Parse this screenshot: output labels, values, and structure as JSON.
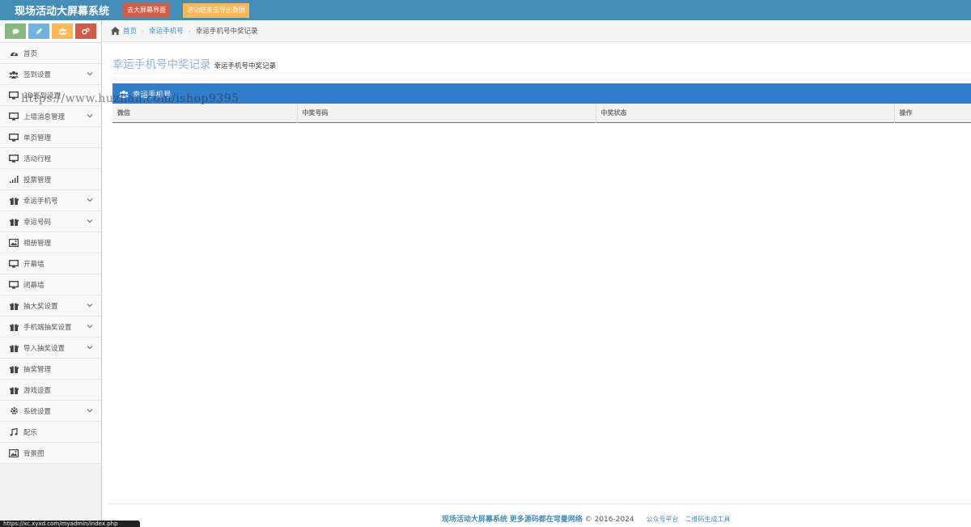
{
  "header": {
    "brand": "现场活动大屏幕系统",
    "btn_bigscreen": "去大屏幕界面",
    "btn_export": "活动结束去导出数据"
  },
  "sidebar": {
    "items": [
      {
        "label": "首页",
        "icon": "dashboard-icon",
        "expandable": false
      },
      {
        "label": "签到设置",
        "icon": "users-icon",
        "expandable": true
      },
      {
        "label": "3D签到设置",
        "icon": "desktop-icon",
        "expandable": false
      },
      {
        "label": "上墙消息管理",
        "icon": "desktop-icon",
        "expandable": true
      },
      {
        "label": "单页管理",
        "icon": "desktop-icon",
        "expandable": false
      },
      {
        "label": "活动行程",
        "icon": "desktop-icon",
        "expandable": false
      },
      {
        "label": "投票管理",
        "icon": "signal-icon",
        "expandable": false
      },
      {
        "label": "幸运手机号",
        "icon": "gift-icon",
        "expandable": true
      },
      {
        "label": "幸运号码",
        "icon": "gift-icon",
        "expandable": true
      },
      {
        "label": "相册管理",
        "icon": "picture-icon",
        "expandable": false
      },
      {
        "label": "开幕墙",
        "icon": "desktop-icon",
        "expandable": false
      },
      {
        "label": "闭幕墙",
        "icon": "desktop-icon",
        "expandable": false
      },
      {
        "label": "抽大奖设置",
        "icon": "gift-icon",
        "expandable": true
      },
      {
        "label": "手机端抽奖设置",
        "icon": "gift-icon",
        "expandable": true
      },
      {
        "label": "导入抽奖设置",
        "icon": "gift-icon",
        "expandable": true
      },
      {
        "label": "抽奖管理",
        "icon": "gift-icon",
        "expandable": false
      },
      {
        "label": "游戏设置",
        "icon": "gift-icon",
        "expandable": false
      },
      {
        "label": "系统设置",
        "icon": "gear-icon",
        "expandable": true
      },
      {
        "label": "配乐",
        "icon": "music-icon",
        "expandable": false
      },
      {
        "label": "背景图",
        "icon": "picture-icon",
        "expandable": false
      }
    ]
  },
  "breadcrumb": {
    "home": "首页",
    "section": "幸运手机号",
    "current": "幸运手机号中奖记录"
  },
  "page": {
    "title": "幸运手机号中奖记录",
    "subtitle": "幸运手机号中奖记录"
  },
  "box": {
    "title": "幸运手机号"
  },
  "table": {
    "columns": [
      "微信",
      "中奖号码",
      "中奖状态",
      "操作"
    ]
  },
  "watermark": "https://www.huzhan.com/ishop9395",
  "footer": {
    "brand": "现场活动大屏幕系统",
    "tagline": "更多源码都在穹曼网络",
    "copyright": "© 2016-2024",
    "link1": "公众号平台",
    "link2": "二维码生成工具"
  },
  "statusbar": "https://xc.xyxd.com/myadmin/index.php"
}
